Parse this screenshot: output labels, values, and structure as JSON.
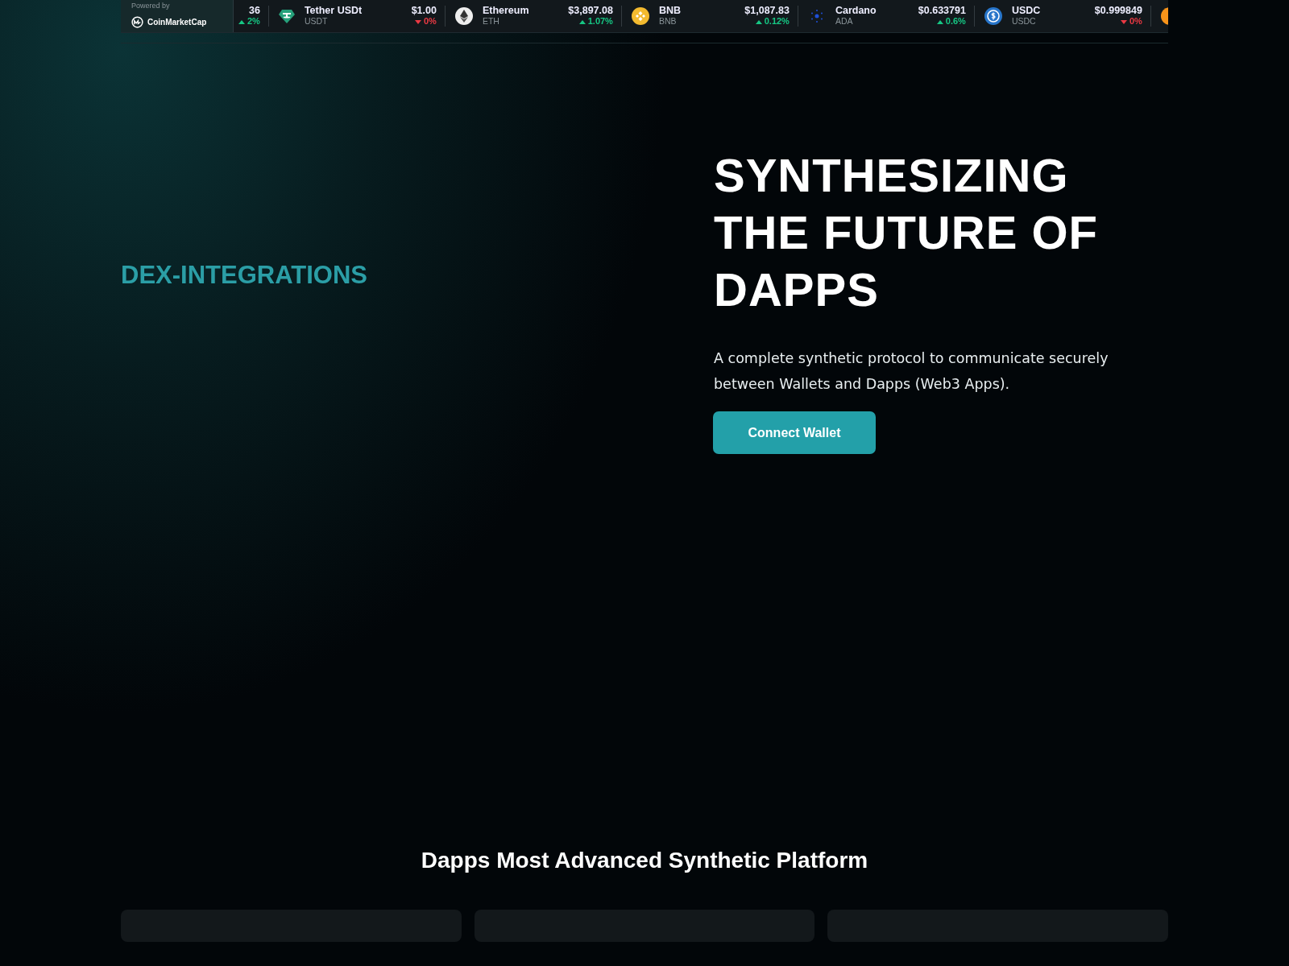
{
  "ticker": {
    "powered_by": "Powered by",
    "brand": "CoinMarketCap",
    "items": [
      {
        "kind": "partial",
        "price": "36",
        "change": "2%",
        "up": true
      },
      {
        "kind": "coin",
        "name": "Tether USDt",
        "symbol": "USDT",
        "price": "$1.00",
        "change": "0%",
        "up": false
      },
      {
        "kind": "coin",
        "name": "Ethereum",
        "symbol": "ETH",
        "price": "$3,897.08",
        "change": "1.07%",
        "up": true
      },
      {
        "kind": "coin",
        "name": "BNB",
        "symbol": "BNB",
        "price": "$1,087.83",
        "change": "0.12%",
        "up": true
      },
      {
        "kind": "coin",
        "name": "Cardano",
        "symbol": "ADA",
        "price": "$0.633791",
        "change": "0.6%",
        "up": true
      },
      {
        "kind": "coin",
        "name": "USDC",
        "symbol": "USDC",
        "price": "$0.999849",
        "change": "0%",
        "up": false
      },
      {
        "kind": "icon-only"
      }
    ]
  },
  "hero": {
    "tag": "DEX-INTEGRATIONS",
    "title": "SYNTHESIZING THE FUTURE OF DAPPS",
    "text": "A complete synthetic protocol to communicate securely between Wallets and Dapps (Web3 Apps).",
    "button": "Connect Wallet"
  },
  "section": {
    "title": "Dapps Most Advanced Synthetic Platform"
  }
}
